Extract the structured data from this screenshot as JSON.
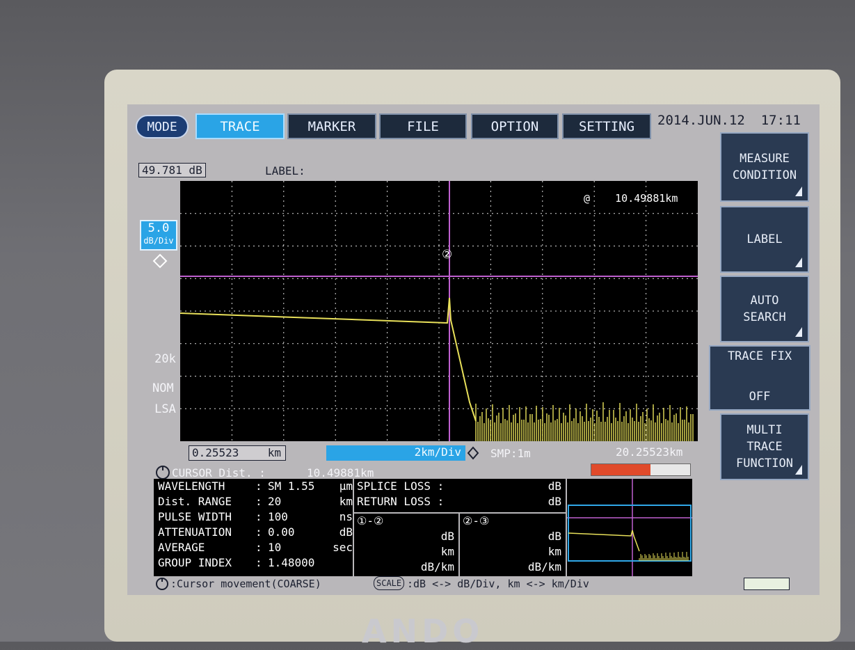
{
  "tabs": {
    "mode": "MODE",
    "trace": "TRACE",
    "marker": "MARKER",
    "file": "FILE",
    "option": "OPTION",
    "setting": "SETTING"
  },
  "datetime": {
    "date": "2014.JUN.12",
    "time": "17:11"
  },
  "header": {
    "level_value": "49.781 dB",
    "label_text": "LABEL:"
  },
  "scale": {
    "db_div_value": "5.0",
    "db_div_unit": "dB/Div",
    "lsa_line1": "20k",
    "lsa_line2": "LSA",
    "nom": "NOM"
  },
  "marker": {
    "symbol": "@",
    "distance": "10.49881km",
    "cursor_symbol": "②"
  },
  "xaxis": {
    "start": "0.25523",
    "start_unit": "km",
    "div": "2km/Div",
    "smp": "SMP:1m",
    "end": "20.25523km"
  },
  "cursor_dist": {
    "label": "CURSOR Dist. :",
    "value": "10.49881km"
  },
  "side_buttons": {
    "measure_l1": "MEASURE",
    "measure_l2": "CONDITION",
    "label": "LABEL",
    "auto_l1": "AUTO",
    "auto_l2": "SEARCH",
    "tracefix_l1": "TRACE FIX",
    "tracefix_l2": "OFF",
    "multi_l1": "MULTI",
    "multi_l2": "TRACE",
    "multi_l3": "FUNCTION"
  },
  "conditions": [
    {
      "key": "WAVELENGTH",
      "value": "SM 1.55",
      "unit": "µm"
    },
    {
      "key": "Dist. RANGE",
      "value": "20",
      "unit": "km"
    },
    {
      "key": "PULSE WIDTH",
      "value": "100",
      "unit": "ns"
    },
    {
      "key": "ATTENUATION",
      "value": "0.00",
      "unit": "dB"
    },
    {
      "key": "AVERAGE",
      "value": "10",
      "unit": "sec"
    },
    {
      "key": "GROUP INDEX",
      "value": "1.48000",
      "unit": ""
    }
  ],
  "loss": {
    "splice": "SPLICE LOSS :",
    "return": "RETURN LOSS :",
    "unit": "dB"
  },
  "sections": {
    "s12": "①-②",
    "s23": "②-③",
    "db": "dB",
    "km": "km",
    "dbkm": "dB/km"
  },
  "status": {
    "text": ":Cursor movement(COARSE)",
    "scale": "SCALE",
    "scale_text": ":dB <-> dB/Div, km <-> km/Div"
  },
  "colors": {
    "trace": "#e8e05a",
    "cursor": "#c060d0",
    "tab_active": "#2aa4e6",
    "mini_box": "#30a8e8"
  }
}
